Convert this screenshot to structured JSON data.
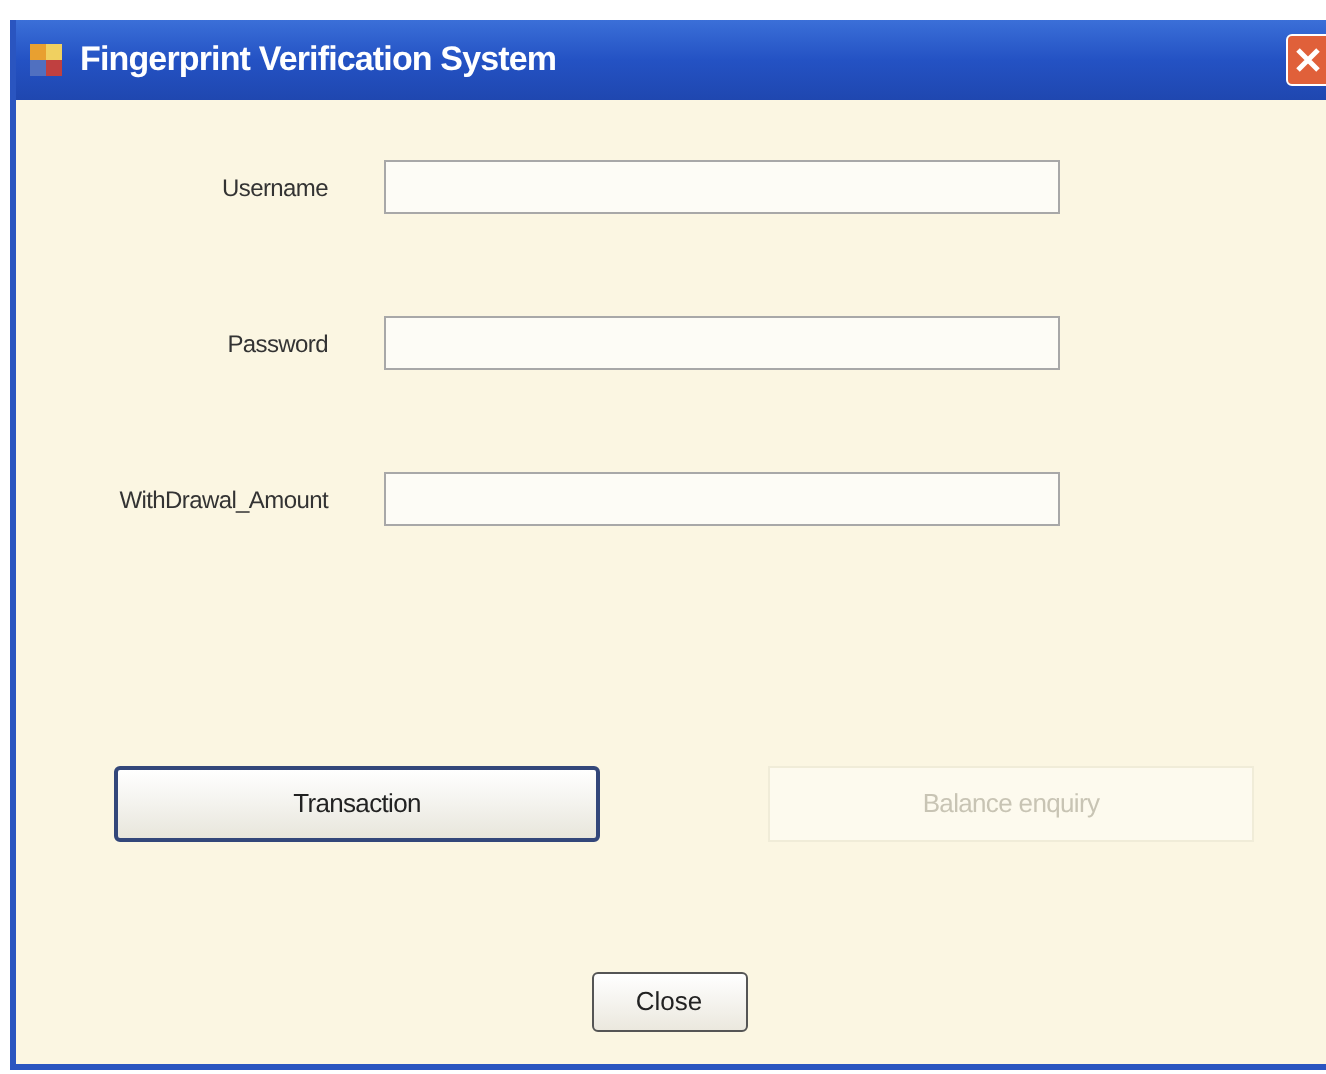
{
  "window": {
    "title": "Fingerprint Verification System"
  },
  "fields": [
    {
      "label": "Username"
    },
    {
      "label": "Password"
    },
    {
      "label": "WithDrawal_Amount"
    }
  ],
  "buttons": [
    {
      "label": "Transaction",
      "disabled": false,
      "focused": true
    },
    {
      "label": "Balance enquiry",
      "disabled": true,
      "focused": false
    }
  ],
  "close_button": {
    "label": "Close"
  }
}
